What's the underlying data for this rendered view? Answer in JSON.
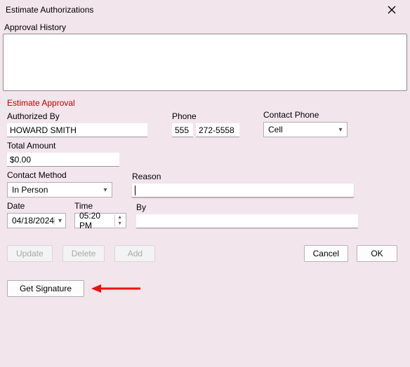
{
  "window": {
    "title": "Estimate Authorizations"
  },
  "approval_history": {
    "label": "Approval History",
    "content": ""
  },
  "estimate_approval": {
    "heading": "Estimate Approval",
    "authorized_by": {
      "label": "Authorized By",
      "value": "HOWARD SMITH"
    },
    "phone": {
      "label": "Phone",
      "area": "555",
      "number": "272-5558"
    },
    "contact_phone": {
      "label": "Contact Phone",
      "value": "Cell"
    },
    "total_amount": {
      "label": "Total Amount",
      "value": "$0.00"
    },
    "contact_method": {
      "label": "Contact Method",
      "value": "In Person"
    },
    "reason": {
      "label": "Reason",
      "value": ""
    },
    "date": {
      "label": "Date",
      "value": "04/18/2024"
    },
    "time": {
      "label": "Time",
      "value": "05:20 PM"
    },
    "by": {
      "label": "By",
      "value": ""
    }
  },
  "buttons": {
    "update": "Update",
    "delete": "Delete",
    "add": "Add",
    "cancel": "Cancel",
    "ok": "OK",
    "get_signature": "Get Signature"
  }
}
